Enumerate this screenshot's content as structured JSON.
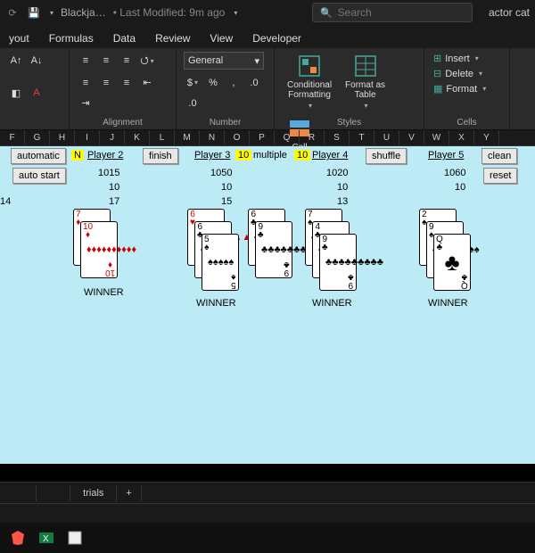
{
  "title": {
    "doc": "Blackja…",
    "modified": "• Last Modified: 9m ago",
    "search_placeholder": "Search",
    "user": "actor cat"
  },
  "tabs": {
    "layout": "yout",
    "formulas": "Formulas",
    "data": "Data",
    "review": "Review",
    "view": "View",
    "developer": "Developer"
  },
  "ribbon": {
    "number_format": "General",
    "groups": {
      "alignment": "Alignment",
      "number": "Number",
      "styles": "Styles",
      "cells": "Cells"
    },
    "cond": "Conditional\nFormatting",
    "fmt_table": "Format as\nTable",
    "cell_styles": "Cell\nStyles",
    "insert": "Insert",
    "delete": "Delete",
    "format": "Format"
  },
  "cols": [
    "F",
    "G",
    "H",
    "I",
    "J",
    "K",
    "L",
    "M",
    "N",
    "O",
    "P",
    "Q",
    "R",
    "S",
    "T",
    "U",
    "V",
    "W",
    "X",
    "Y"
  ],
  "game": {
    "automatic": "automatic",
    "n": "N",
    "p2": "Player 2",
    "p3": "Player 3",
    "p4": "Player 4",
    "p5": "Player 5",
    "finish": "finish",
    "ten_a": "10",
    "multiple": "multiple",
    "ten_b": "10",
    "shuffle": "shuffle",
    "clean": "clean",
    "autostart": "auto start",
    "reset": "reset",
    "b2": "1015",
    "b3": "1050",
    "b4": "1020",
    "b5": "1060",
    "bet2": "10",
    "bet3": "10",
    "bet4": "10",
    "bet5": "10",
    "s1": "14",
    "s2": "17",
    "s3": "15",
    "s4": "13",
    "s5": "",
    "winner": "WINNER"
  },
  "sheets": {
    "trials": "trials",
    "plus": "+"
  }
}
